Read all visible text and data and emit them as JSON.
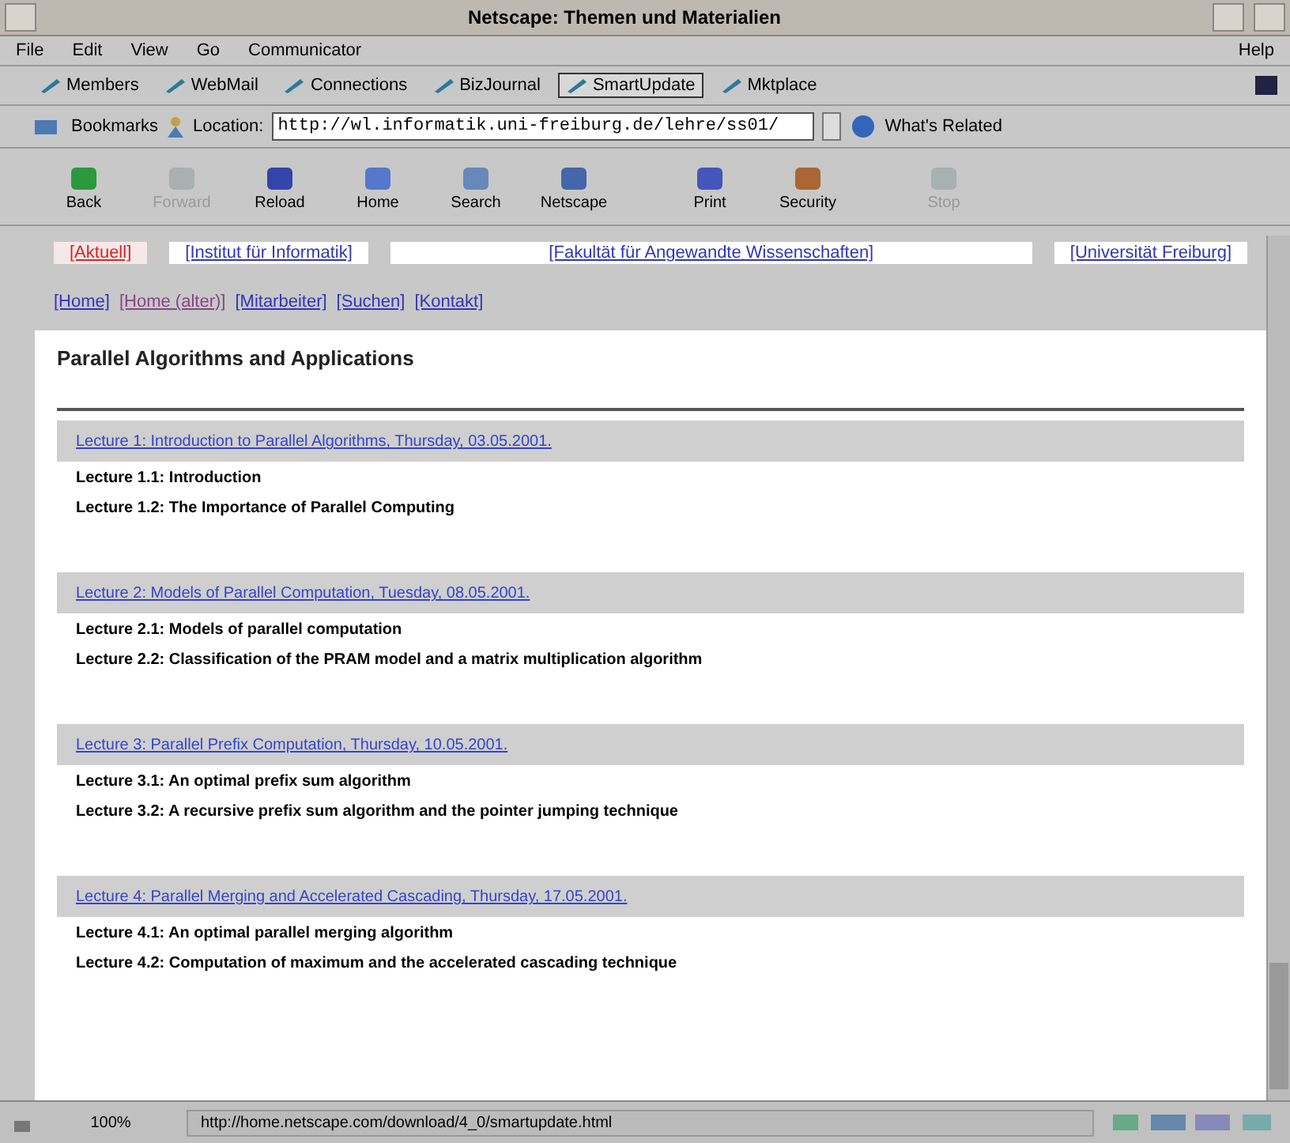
{
  "window": {
    "title": "Netscape: Themen und Materialien"
  },
  "menu": [
    {
      "label": "File"
    },
    {
      "label": "Edit"
    },
    {
      "label": "View"
    },
    {
      "label": "Go"
    },
    {
      "label": "Communicator"
    }
  ],
  "menu_help": "Help",
  "personal_toolbar": [
    {
      "label": "Members",
      "selected": false
    },
    {
      "label": "WebMail",
      "selected": false
    },
    {
      "label": "Connections",
      "selected": false
    },
    {
      "label": "BizJournal",
      "selected": false
    },
    {
      "label": "SmartUpdate",
      "selected": true
    },
    {
      "label": "Mktplace",
      "selected": false
    }
  ],
  "location_bar": {
    "bookmarks": "Bookmarks",
    "location_label": "Location:",
    "url": "http://wl.informatik.uni-freiburg.de/lehre/ss01/",
    "related": "What's Related"
  },
  "nav_toolbar": [
    {
      "label": "Back",
      "kind": "back",
      "disabled": false
    },
    {
      "label": "Forward",
      "kind": "forward",
      "disabled": true
    },
    {
      "label": "Reload",
      "kind": "reload",
      "disabled": false
    },
    {
      "label": "Home",
      "kind": "home",
      "disabled": false
    },
    {
      "label": "Search",
      "kind": "search",
      "disabled": false
    },
    {
      "label": "Netscape",
      "kind": "netscape",
      "disabled": false
    },
    {
      "label": "Print",
      "kind": "print",
      "disabled": false
    },
    {
      "label": "Security",
      "kind": "security",
      "disabled": false
    },
    {
      "label": "Stop",
      "kind": "stop",
      "disabled": true
    }
  ],
  "top_links": [
    {
      "label": "[Aktuell]",
      "selected": true
    },
    {
      "label": "[Institut für Informatik]",
      "selected": false
    },
    {
      "label": "[Fakultät für Angewandte Wissenschaften]",
      "selected": false
    },
    {
      "label": "[Universität Freiburg]",
      "selected": false
    }
  ],
  "sub_links": [
    {
      "label": "[Home]",
      "visited": false
    },
    {
      "label": "[Home (alter)]",
      "visited": true
    },
    {
      "label": "[Mitarbeiter]",
      "visited": false
    },
    {
      "label": "[Suchen]",
      "visited": false
    },
    {
      "label": "[Kontakt]",
      "visited": false
    }
  ],
  "page_title": "Parallel Algorithms and Applications",
  "lectures": [
    {
      "title": "Lecture 1: Introduction to Parallel Algorithms, Thursday, 03.05.2001.",
      "items": [
        "Lecture 1.1: Introduction",
        "Lecture 1.2: The Importance of Parallel Computing"
      ]
    },
    {
      "title": "Lecture 2: Models of Parallel Computation, Tuesday, 08.05.2001.",
      "items": [
        "Lecture 2.1: Models of parallel computation",
        "Lecture 2.2: Classification of the PRAM model and a matrix multiplication algorithm"
      ]
    },
    {
      "title": "Lecture 3: Parallel Prefix Computation, Thursday, 10.05.2001.",
      "items": [
        "Lecture 3.1: An optimal prefix sum algorithm",
        "Lecture 3.2: A recursive prefix sum algorithm and the pointer jumping technique"
      ]
    },
    {
      "title": "Lecture 4: Parallel Merging and Accelerated Cascading, Thursday, 17.05.2001.",
      "items": [
        "Lecture 4.1: An optimal parallel merging algorithm",
        "Lecture 4.2: Computation of maximum and the accelerated cascading technique"
      ]
    }
  ],
  "status_bar": {
    "progress": "100%",
    "message": "http://home.netscape.com/download/4_0/smartupdate.html"
  }
}
